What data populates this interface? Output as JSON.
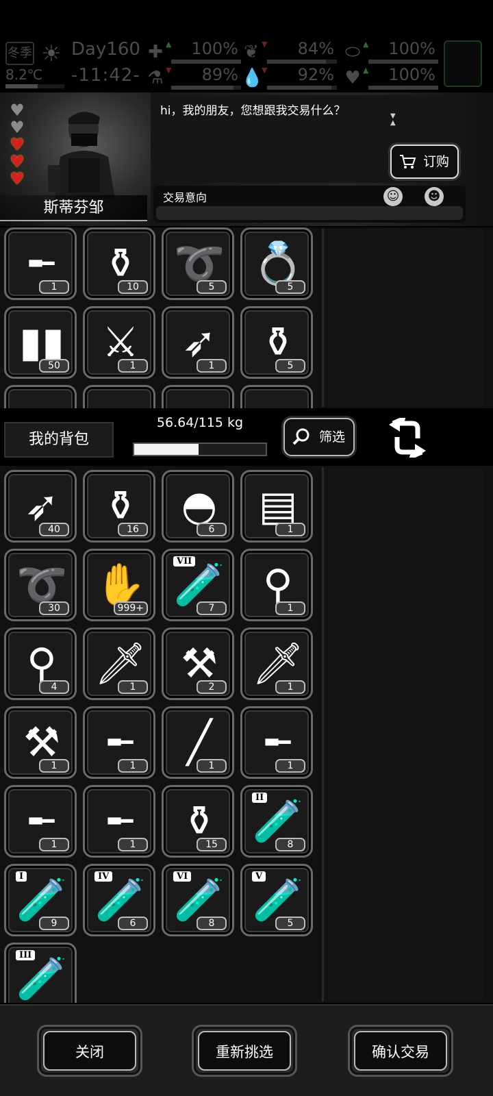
{
  "status": {
    "season": "冬季",
    "day": "Day160",
    "clock": "-11:42-",
    "temperature": "8.2℃",
    "temperature_level": 0.55,
    "stats": [
      {
        "name": "health-kit",
        "icon": "medkit-icon",
        "value": "100%",
        "level": 1.0,
        "trend": "up"
      },
      {
        "name": "hunger",
        "icon": "stomach-icon",
        "value": "84%",
        "level": 0.84,
        "trend": "down"
      },
      {
        "name": "energy",
        "icon": "pill-icon",
        "value": "100%",
        "level": 1.0,
        "trend": "up"
      },
      {
        "name": "sanity",
        "icon": "brain-icon",
        "value": "89%",
        "level": 0.89,
        "trend": "down"
      },
      {
        "name": "thirst",
        "icon": "water-drop-icon",
        "value": "92%",
        "level": 0.92,
        "trend": "down"
      },
      {
        "name": "heart",
        "icon": "heart-icon",
        "value": "100%",
        "level": 1.0,
        "trend": "up"
      }
    ]
  },
  "trader": {
    "name": "斯蒂芬邹",
    "hearts_full": 3,
    "hearts_total": 5,
    "dialog": "hi，我的朋友，您想跟我交易什么？",
    "order_label": "订购",
    "intent_label": "交易意向",
    "intent_level": 0.5
  },
  "trader_items": [
    {
      "icon": "sniper-rifle-icon",
      "glyph": "╾",
      "qty": "1"
    },
    {
      "icon": "bottles-icon",
      "glyph": "⚱",
      "qty": "10"
    },
    {
      "icon": "barbed-wire-icon",
      "glyph": "➰",
      "qty": "5"
    },
    {
      "icon": "ring-icon",
      "glyph": "💍",
      "qty": "5"
    },
    {
      "icon": "bullets-icon",
      "glyph": "▮▮",
      "qty": "50"
    },
    {
      "icon": "leg-guards-icon",
      "glyph": "⚔",
      "qty": "1"
    },
    {
      "icon": "rpg-launcher-icon",
      "glyph": "➶",
      "qty": "1"
    },
    {
      "icon": "vase-icon",
      "glyph": "⚱",
      "qty": "5"
    },
    {
      "icon": "grenade-icon",
      "glyph": "●",
      "qty": ""
    },
    {
      "icon": "can-icon",
      "glyph": "▬",
      "qty": ""
    },
    {
      "icon": "tape-icon",
      "glyph": "▬",
      "qty": ""
    },
    {
      "icon": "bricks-icon",
      "glyph": "▬",
      "qty": ""
    }
  ],
  "backpack": {
    "title": "我的背包",
    "weight": "56.64/115 kg",
    "weight_level": 0.49,
    "filter_label": "筛选"
  },
  "backpack_items": [
    {
      "icon": "arrow-icon",
      "glyph": "➶",
      "qty": "40"
    },
    {
      "icon": "bottles-icon",
      "glyph": "⚱",
      "qty": "16"
    },
    {
      "icon": "bandage-roll-icon",
      "glyph": "◓",
      "qty": "6"
    },
    {
      "icon": "cloth-icon",
      "glyph": "▤",
      "qty": "1"
    },
    {
      "icon": "barbed-wire-icon",
      "glyph": "➰",
      "qty": "30"
    },
    {
      "icon": "zombie-card-icon",
      "glyph": "✋",
      "qty": "999+"
    },
    {
      "icon": "test-tube-vii-icon",
      "glyph": "🧪",
      "qty": "7",
      "tag": "VII"
    },
    {
      "icon": "sprayer-icon",
      "glyph": "⚲",
      "qty": "1"
    },
    {
      "icon": "flamethrower-icon",
      "glyph": "⚲",
      "qty": "4"
    },
    {
      "icon": "machete-icon",
      "glyph": "🗡",
      "qty": "1"
    },
    {
      "icon": "caulking-gun-icon",
      "glyph": "⚒",
      "qty": "2"
    },
    {
      "icon": "blade-icon",
      "glyph": "🗡",
      "qty": "1"
    },
    {
      "icon": "shovel-icon",
      "glyph": "⚒",
      "qty": "1"
    },
    {
      "icon": "revolver-icon",
      "glyph": "╾",
      "qty": "1"
    },
    {
      "icon": "spiked-bat-icon",
      "glyph": "╱",
      "qty": "1"
    },
    {
      "icon": "rifle-icon",
      "glyph": "╾",
      "qty": "1"
    },
    {
      "icon": "shotgun-icon",
      "glyph": "╾",
      "qty": "1"
    },
    {
      "icon": "grenade-launcher-icon",
      "glyph": "╾",
      "qty": "1"
    },
    {
      "icon": "plastic-bottle-icon",
      "glyph": "⚱",
      "qty": "15"
    },
    {
      "icon": "test-tube-ii-icon",
      "glyph": "🧪",
      "qty": "8",
      "tag": "II"
    },
    {
      "icon": "test-tube-i-icon",
      "glyph": "🧪",
      "qty": "9",
      "tag": "I"
    },
    {
      "icon": "test-tube-iv-icon",
      "glyph": "🧪",
      "qty": "6",
      "tag": "IV"
    },
    {
      "icon": "test-tube-vi-icon",
      "glyph": "🧪",
      "qty": "8",
      "tag": "VI"
    },
    {
      "icon": "test-tube-v-icon",
      "glyph": "🧪",
      "qty": "5",
      "tag": "V"
    },
    {
      "icon": "test-tube-iii-icon",
      "glyph": "🧪",
      "qty": "",
      "tag": "III"
    }
  ],
  "buttons": {
    "close": "关闭",
    "reselect": "重新挑选",
    "confirm": "确认交易"
  }
}
